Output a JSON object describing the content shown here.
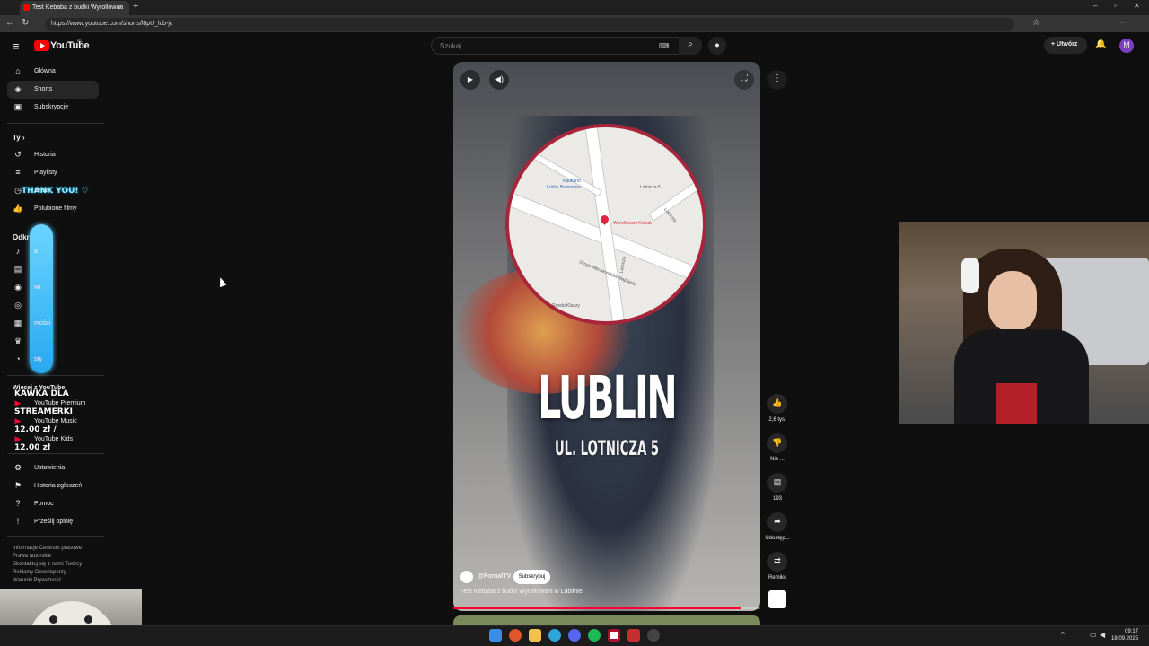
{
  "browser": {
    "tab_title": "Test Kebaba z budki Wyrollowan",
    "url": "https://www.youtube.com/shorts/l8pU_lcb-jc",
    "new_tab": "+",
    "tab_close": "×",
    "win_min": "–",
    "win_max": "▫",
    "win_close": "✕"
  },
  "header": {
    "logo_text": "YouTube",
    "region": "PL",
    "search_placeholder": "Szukaj",
    "create_label": "Utwórz",
    "avatar_letter": "M"
  },
  "sidebar": {
    "main": [
      {
        "label": "Główna",
        "icon": "home-icon",
        "glyph": "⌂"
      },
      {
        "label": "Shorts",
        "icon": "shorts-icon",
        "glyph": "◈"
      },
      {
        "label": "Subskrypcje",
        "icon": "subscriptions-icon",
        "glyph": "▣"
      }
    ],
    "you_heading": "Ty",
    "you": [
      {
        "label": "Historia",
        "icon": "history-icon",
        "glyph": "↺"
      },
      {
        "label": "Playlisty",
        "icon": "playlists-icon",
        "glyph": "≡"
      },
      {
        "label": "zenia",
        "icon": "watch-later-icon",
        "glyph": "◷"
      },
      {
        "label": "Polubione filmy",
        "icon": "like-icon",
        "glyph": "👍"
      }
    ],
    "explore_heading": "Odkr",
    "explore": [
      {
        "label": "a",
        "icon": "music-icon",
        "glyph": "♪"
      },
      {
        "label": "",
        "icon": "movies-icon",
        "glyph": "▤"
      },
      {
        "label": "vo",
        "icon": "live-icon",
        "glyph": "◉"
      },
      {
        "label": "",
        "icon": "gaming-icon",
        "glyph": "◎"
      },
      {
        "label": "mości",
        "icon": "news-icon",
        "glyph": "▦"
      },
      {
        "label": "",
        "icon": "trophy-icon",
        "glyph": "♛"
      },
      {
        "label": "sty",
        "icon": "podcast-icon",
        "glyph": "◔"
      }
    ],
    "more_heading": "Więcej z YouTube",
    "more": [
      {
        "label": "YouTube Premium",
        "icon": "yt-premium-icon"
      },
      {
        "label": "YouTube Music",
        "icon": "yt-music-icon"
      },
      {
        "label": "YouTube Kids",
        "icon": "yt-kids-icon"
      }
    ],
    "settings": [
      {
        "label": "Ustawienia",
        "icon": "settings-icon",
        "glyph": "⚙"
      },
      {
        "label": "Historia zgłoszeń",
        "icon": "flag-icon",
        "glyph": "⚑"
      },
      {
        "label": "Pomoc",
        "icon": "help-icon",
        "glyph": "?"
      },
      {
        "label": "Prześlij opinię",
        "icon": "feedback-icon",
        "glyph": "!"
      }
    ],
    "footer": [
      "Informacje  Centrum prasowe",
      "Prawa autorskie",
      "Skontaktuj się z nami  Twórcy",
      "Reklamy  Deweloperzy",
      "Warunki  Prywatność"
    ]
  },
  "overlay": {
    "thanks": "THANK YOU! ♡",
    "kawka1": "KAWKA DLA",
    "kawka2": "STREAMERKI",
    "price1": "12.00 zł /",
    "price2": "12.00 zł"
  },
  "video": {
    "city": "LUBLIN",
    "street": "UL. LOTNICZA 5",
    "channel": "@FornalTV",
    "subscribe": "Subskrybuj",
    "title": "Test Kebaba z budki Wyrollowani w Lublinie",
    "progress": 0.94,
    "map_labels": [
      "Kaufland",
      "Lublin Bronowice",
      "Lotnicza 5",
      "Wyrollowani Kebab",
      "Droga Męczenników Majdanka",
      "Lotnicza",
      "Lotnicza",
      "Rondo Kluczy"
    ]
  },
  "actions": {
    "likes": "2,6 tys.",
    "dislike": "Nie ...",
    "comments": "193",
    "share": "Udostęp...",
    "remix": "Remiks"
  },
  "taskbar": {
    "time": "09:17",
    "date": "18.09.2025"
  }
}
